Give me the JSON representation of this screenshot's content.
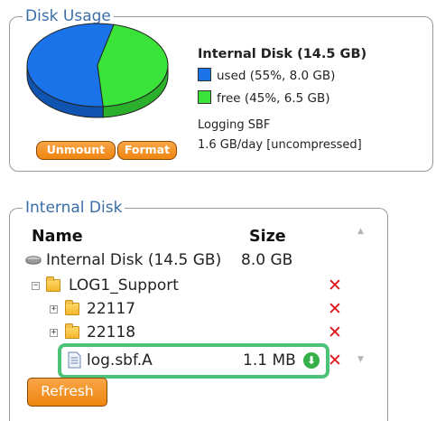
{
  "disk_usage": {
    "legend": "Disk Usage",
    "disk_title": "Internal Disk (14.5 GB)",
    "used_label": "used (55%, 8.0 GB)",
    "free_label": "free (45%, 6.5 GB)",
    "used_fraction": 0.55,
    "used_color": "#1a73e8",
    "free_color": "#39e33a",
    "logging_label": "Logging SBF",
    "logging_rate": "1.6 GB/day [uncompressed]",
    "unmount_label": "Unmount",
    "format_label": "Format"
  },
  "internal_disk": {
    "legend": "Internal Disk",
    "col_name": "Name",
    "col_size": "Size",
    "disk_row": {
      "name": "Internal Disk (14.5 GB)",
      "size": "8.0 GB"
    },
    "folders": [
      {
        "name": "LOG1_Support",
        "expander": "−"
      },
      {
        "name": "22117",
        "expander": "+"
      },
      {
        "name": "22118",
        "expander": "+"
      }
    ],
    "file": {
      "name": "log.sbf.A",
      "size": "1.1 MB"
    },
    "refresh_label": "Refresh",
    "delete_glyph": "✕",
    "download_glyph": "⬇"
  }
}
